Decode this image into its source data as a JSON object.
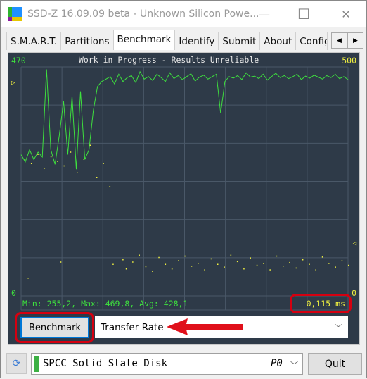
{
  "window": {
    "title": "SSD-Z 16.09.09 beta - Unknown Silicon Powe...",
    "minimize": "—",
    "maximize": "☐",
    "close": "✕"
  },
  "tabs": [
    {
      "label": "S.M.A.R.T."
    },
    {
      "label": "Partitions"
    },
    {
      "label": "Benchmark",
      "active": true
    },
    {
      "label": "Identify"
    },
    {
      "label": "Submit"
    },
    {
      "label": "About"
    },
    {
      "label": "Config"
    }
  ],
  "tab_scroll": {
    "left": "◀",
    "right": "▶"
  },
  "benchmark": {
    "banner": "Work in Progress - Results Unreliable",
    "stats": "Min: 255,2, Max: 469,8, Avg: 428,1",
    "access_time": "0,115 ms",
    "button": "Benchmark",
    "mode": "Transfer Rate"
  },
  "chart_data": {
    "type": "line",
    "left_axis": {
      "max_label": "470",
      "min_label": "0",
      "range": [
        0,
        470
      ],
      "color": "#3ee03e"
    },
    "right_axis": {
      "max_label": "500",
      "min_label": "0",
      "range": [
        0,
        500
      ],
      "color": "#f0f040"
    },
    "grid": true,
    "series": [
      {
        "axis": "left",
        "type": "line",
        "color": "#3ee03e",
        "values": [
          290,
          275,
          300,
          280,
          295,
          285,
          465,
          300,
          270,
          330,
          400,
          290,
          410,
          260,
          420,
          280,
          300,
          380,
          430,
          440,
          445,
          450,
          435,
          455,
          440,
          448,
          452,
          438,
          460,
          445,
          450,
          442,
          455,
          448,
          440,
          458,
          446,
          452,
          444,
          450,
          456,
          441,
          449,
          453,
          445,
          450,
          455,
          375,
          440,
          450,
          447,
          452,
          444,
          458,
          449,
          451,
          446,
          455,
          443,
          450,
          457,
          448,
          452,
          446,
          450,
          455,
          444,
          451,
          447,
          453,
          449,
          445,
          452,
          448,
          455,
          446,
          450,
          444
        ]
      },
      {
        "axis": "right",
        "type": "scatter",
        "color": "#f0f040",
        "points": [
          [
            1,
            300
          ],
          [
            3,
            290
          ],
          [
            5,
            310
          ],
          [
            7,
            280
          ],
          [
            9,
            305
          ],
          [
            11,
            295
          ],
          [
            13,
            285
          ],
          [
            15,
            315
          ],
          [
            17,
            270
          ],
          [
            19,
            300
          ],
          [
            21,
            330
          ],
          [
            23,
            260
          ],
          [
            25,
            290
          ],
          [
            27,
            240
          ],
          [
            28,
            70
          ],
          [
            31,
            80
          ],
          [
            32,
            60
          ],
          [
            34,
            75
          ],
          [
            36,
            90
          ],
          [
            38,
            65
          ],
          [
            40,
            55
          ],
          [
            42,
            85
          ],
          [
            44,
            70
          ],
          [
            46,
            60
          ],
          [
            48,
            78
          ],
          [
            50,
            88
          ],
          [
            52,
            66
          ],
          [
            54,
            72
          ],
          [
            56,
            58
          ],
          [
            58,
            82
          ],
          [
            60,
            70
          ],
          [
            62,
            64
          ],
          [
            64,
            90
          ],
          [
            66,
            76
          ],
          [
            68,
            60
          ],
          [
            70,
            84
          ],
          [
            72,
            68
          ],
          [
            74,
            72
          ],
          [
            76,
            58
          ],
          [
            78,
            88
          ],
          [
            80,
            66
          ],
          [
            82,
            74
          ],
          [
            84,
            62
          ],
          [
            86,
            80
          ],
          [
            88,
            70
          ],
          [
            90,
            58
          ],
          [
            92,
            86
          ],
          [
            94,
            72
          ],
          [
            96,
            64
          ],
          [
            98,
            78
          ],
          [
            100,
            68
          ],
          [
            12,
            75
          ],
          [
            2,
            40
          ]
        ]
      }
    ]
  },
  "drive": {
    "name": "SPCC Solid State Disk",
    "port": "P0",
    "status_color": "#3cb043"
  },
  "quit": "Quit",
  "annotation_colors": {
    "ring": "#d40010",
    "arrow": "#e0101a"
  }
}
